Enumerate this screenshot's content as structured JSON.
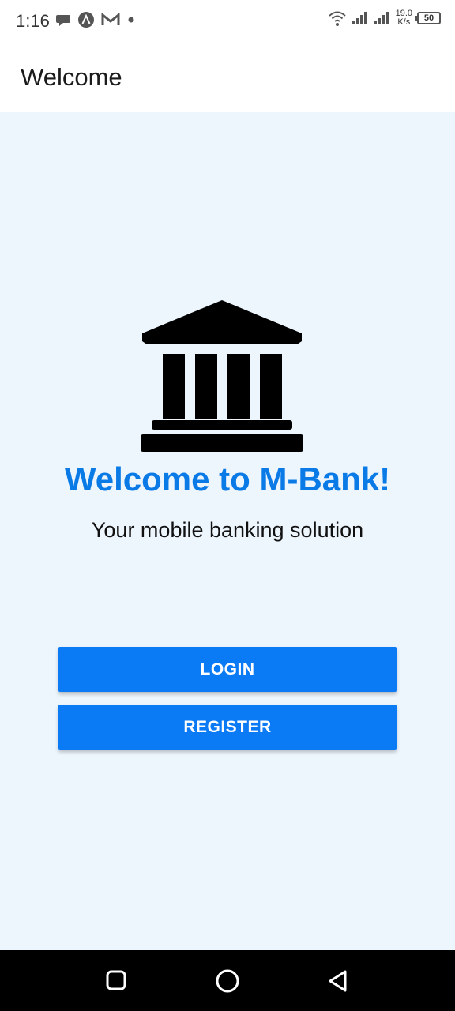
{
  "status_bar": {
    "time": "1:16",
    "net_speed_value": "19.0",
    "net_speed_unit": "K/s",
    "battery": "50",
    "icons": [
      "chat-bubble-icon",
      "app-a-icon",
      "gmail-icon",
      "dot-icon",
      "wifi-icon",
      "signal-icon",
      "signal-icon"
    ]
  },
  "app_bar": {
    "title": "Welcome"
  },
  "main": {
    "icon": "bank-icon",
    "headline": "Welcome to M-Bank!",
    "tagline": "Your mobile banking solution",
    "login_label": "LOGIN",
    "register_label": "REGISTER"
  },
  "colors": {
    "primary": "#0a7af5",
    "headline": "#0a7ae6",
    "background": "#edf5fd"
  },
  "nav_bar": {
    "icons": [
      "recents-icon",
      "home-icon",
      "back-icon"
    ]
  }
}
